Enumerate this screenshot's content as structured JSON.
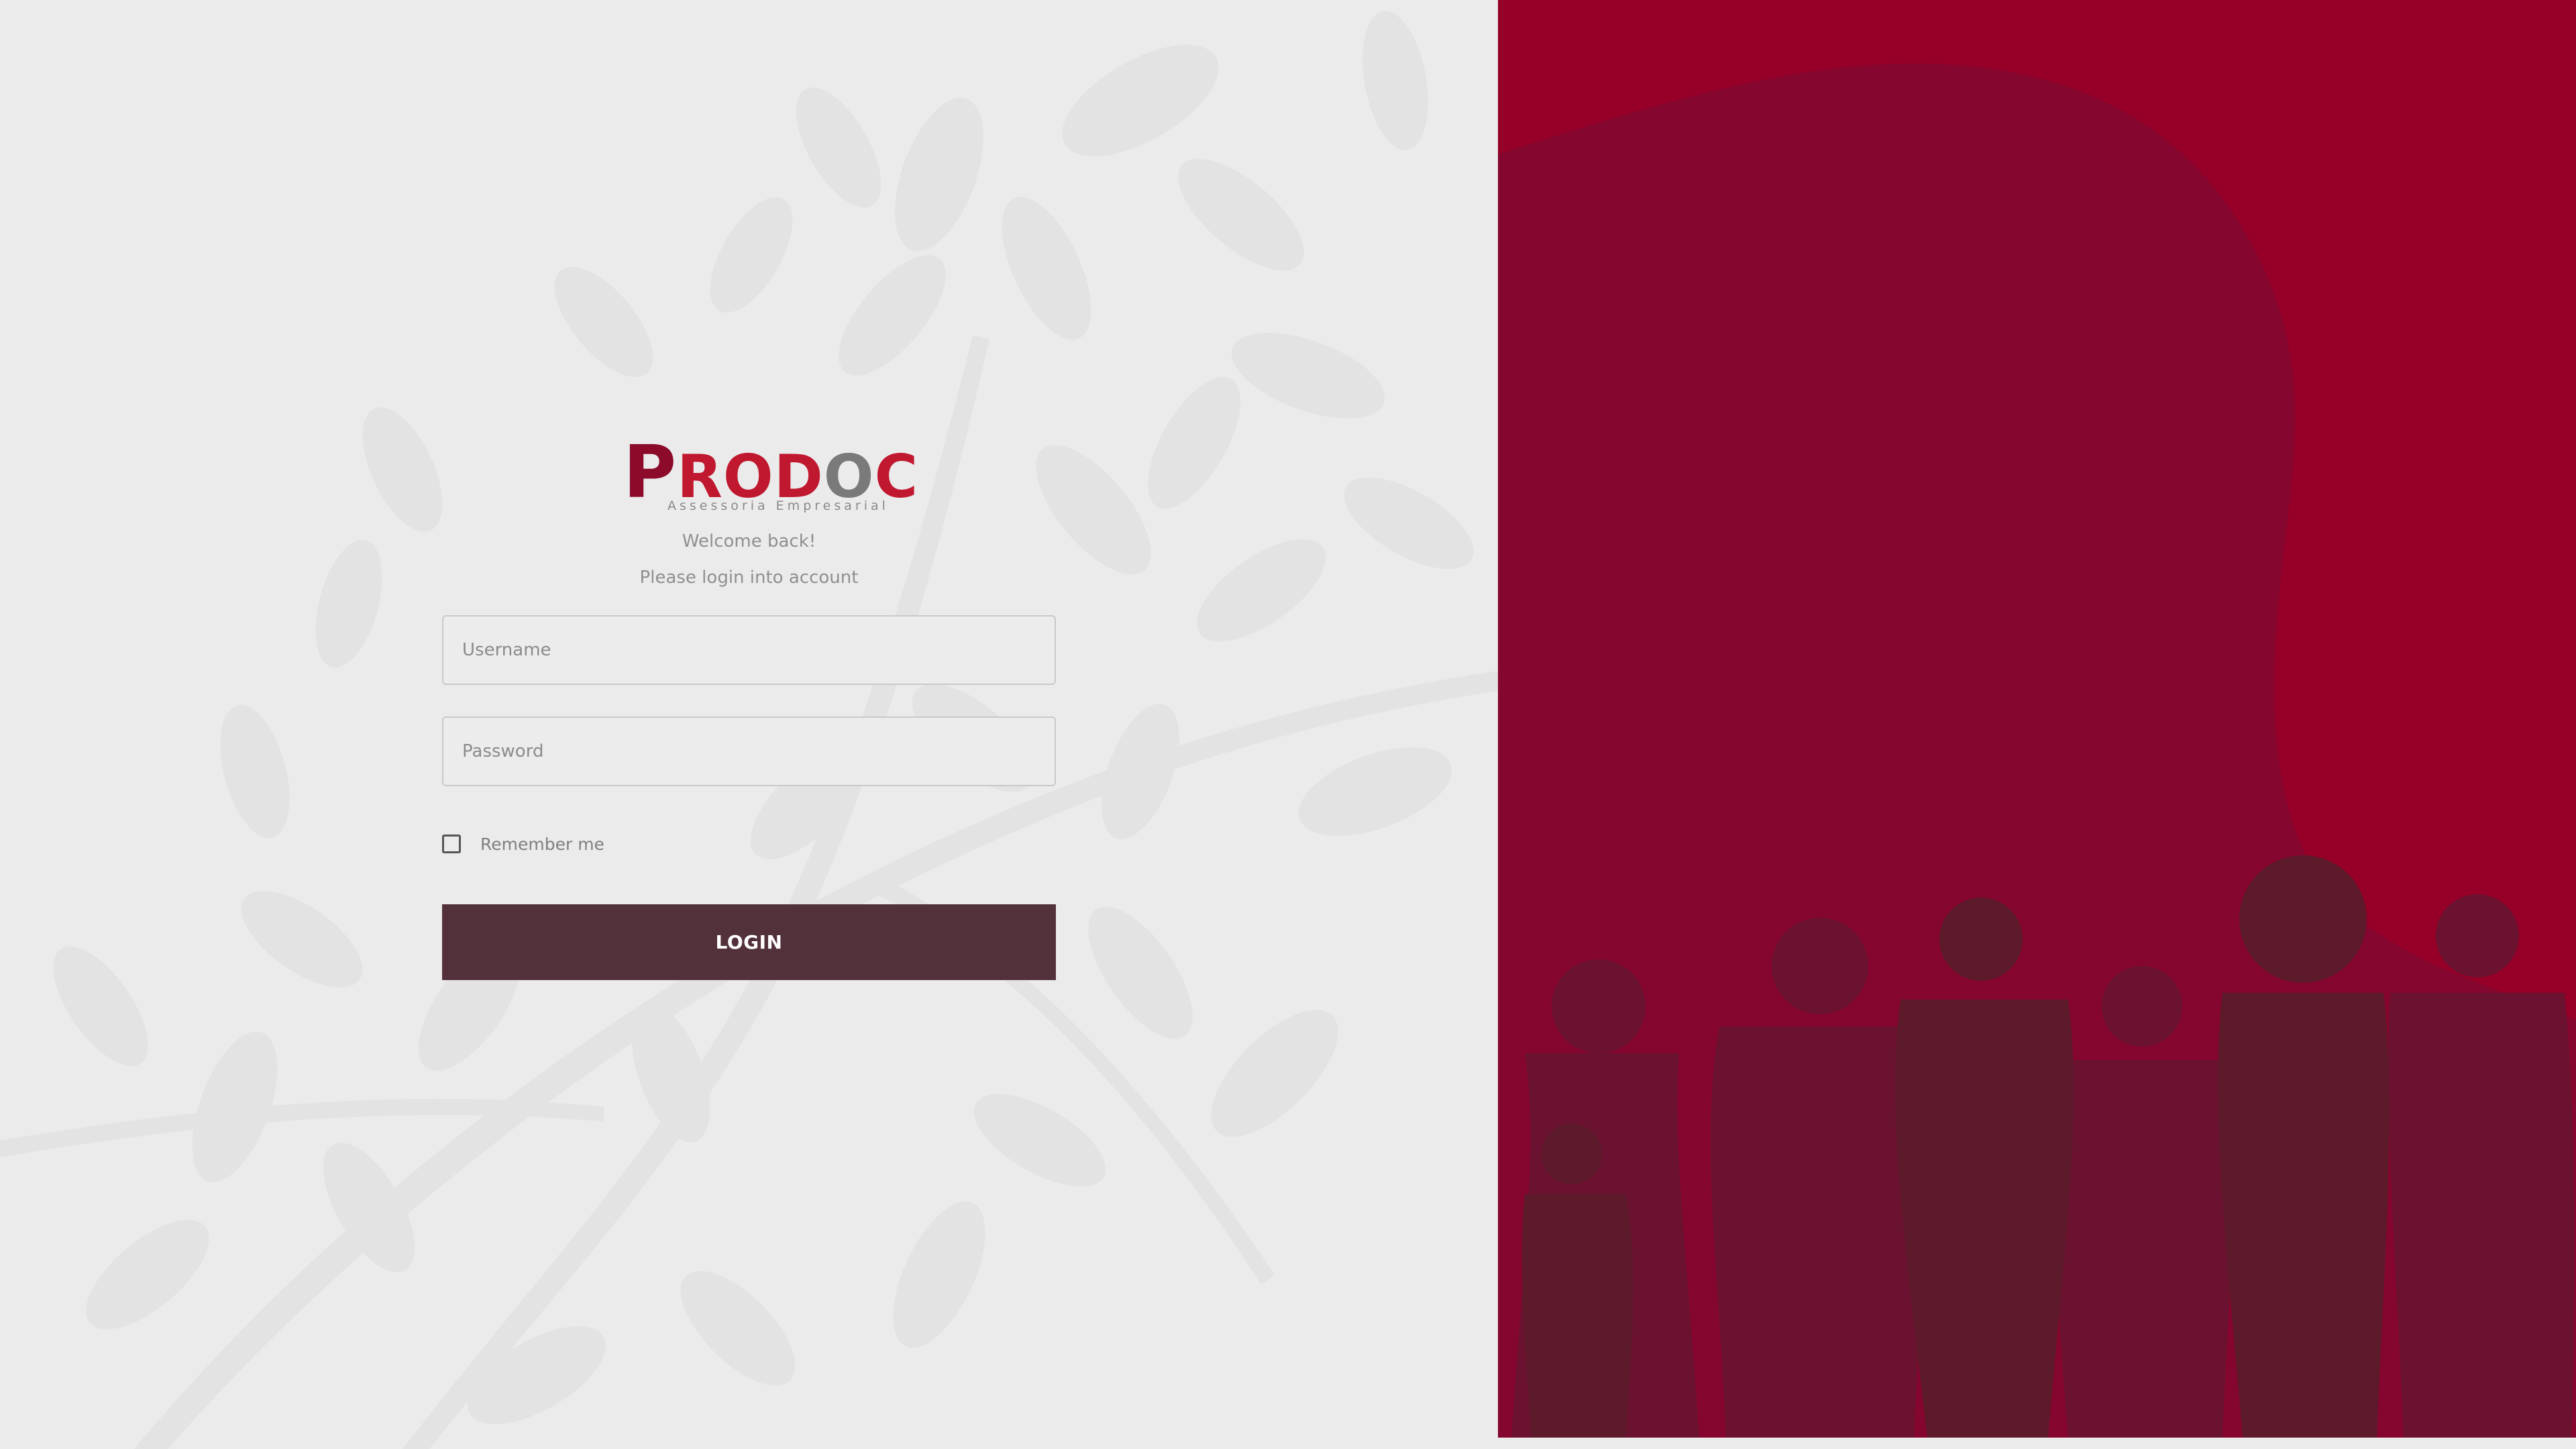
{
  "brand": {
    "logo_letters": {
      "p": "P",
      "rod": "ROD",
      "o": "O",
      "c": "C"
    },
    "tagline": "Assessoria Empresarial"
  },
  "login": {
    "welcome": "Welcome back!",
    "subtitle": "Please login into account",
    "username_placeholder": "Username",
    "password_placeholder": "Password",
    "username_value": "",
    "password_value": "",
    "remember_label": "Remember me",
    "remember_checked": false,
    "submit_label": "LOGIN"
  },
  "colors": {
    "left_background": "#ebebeb",
    "accent": "#960028",
    "button": "#53313b",
    "silhouette_dark": "#5c1a2b"
  },
  "icons": {
    "left_background": "leaf-branch-pattern",
    "right_background": "people-group-silhouette"
  }
}
